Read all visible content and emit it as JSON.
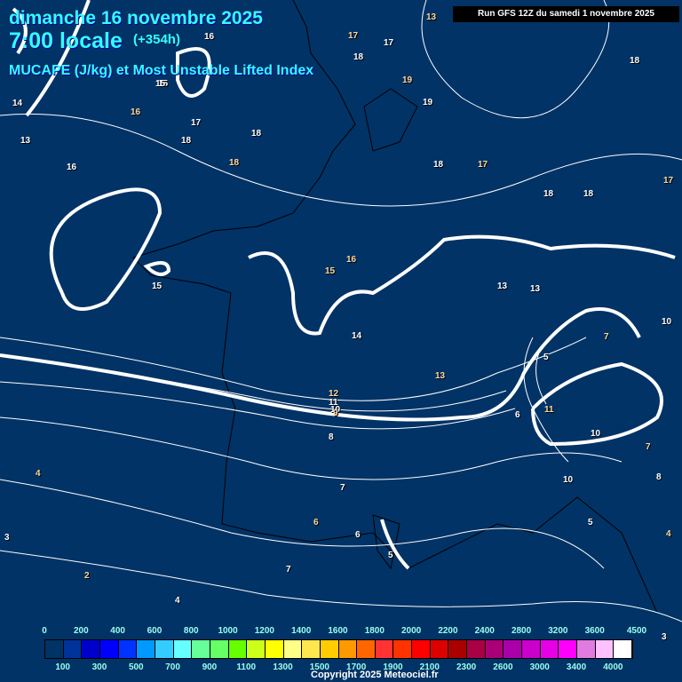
{
  "header": {
    "date": "dimanche 16 novembre 2025",
    "time": "7:00 locale",
    "lead": "(+354h)",
    "parameter": "MUCAPE (J/kg) et Most Unstable Lifted Index",
    "run": "Run GFS 12Z du samedi 1 novembre 2025"
  },
  "legend": {
    "top_labels": [
      "0",
      "200",
      "400",
      "600",
      "800",
      "1000",
      "1200",
      "1400",
      "1600",
      "1800",
      "2000",
      "2200",
      "2400",
      "2800",
      "3200",
      "3600",
      "4500"
    ],
    "bottom_labels": [
      "100",
      "300",
      "500",
      "700",
      "900",
      "1100",
      "1300",
      "1500",
      "1700",
      "1900",
      "2100",
      "2300",
      "2600",
      "3000",
      "3400",
      "4000"
    ],
    "colors": [
      "#00113f",
      "#003366",
      "#003399",
      "#0000cc",
      "#0000ff",
      "#0033ff",
      "#0099ff",
      "#33ccff",
      "#66ffff",
      "#66ff99",
      "#66ff66",
      "#66ff00",
      "#ccff19",
      "#ffff00",
      "#ffff88",
      "#ffe64d",
      "#ffcc00",
      "#ff9900",
      "#ff6600",
      "#ff3333",
      "#ff3300",
      "#ff0000",
      "#dd0000",
      "#aa0000",
      "#aa0044",
      "#aa0077",
      "#aa00aa",
      "#cc00cc",
      "#e600e6",
      "#ff00ff",
      "#e07be0",
      "#ffc0ff",
      "#ffffff"
    ]
  },
  "copyright": "Copyright 2025 Meteociel.fr",
  "contour_labels": [
    "13",
    "15",
    "16",
    "17",
    "17",
    "18",
    "19",
    "18",
    "16",
    "15",
    "14",
    "13",
    "16",
    "17",
    "18",
    "18",
    "19",
    "18",
    "17",
    "18",
    "18",
    "17",
    "18",
    "15",
    "16",
    "15",
    "14",
    "13",
    "13",
    "13",
    "12",
    "11",
    "10",
    "9",
    "8",
    "10",
    "7",
    "6",
    "5",
    "11",
    "10",
    "10",
    "7",
    "8",
    "7",
    "6",
    "6",
    "5",
    "4",
    "4",
    "3",
    "2",
    "7",
    "5",
    "4",
    "3"
  ]
}
